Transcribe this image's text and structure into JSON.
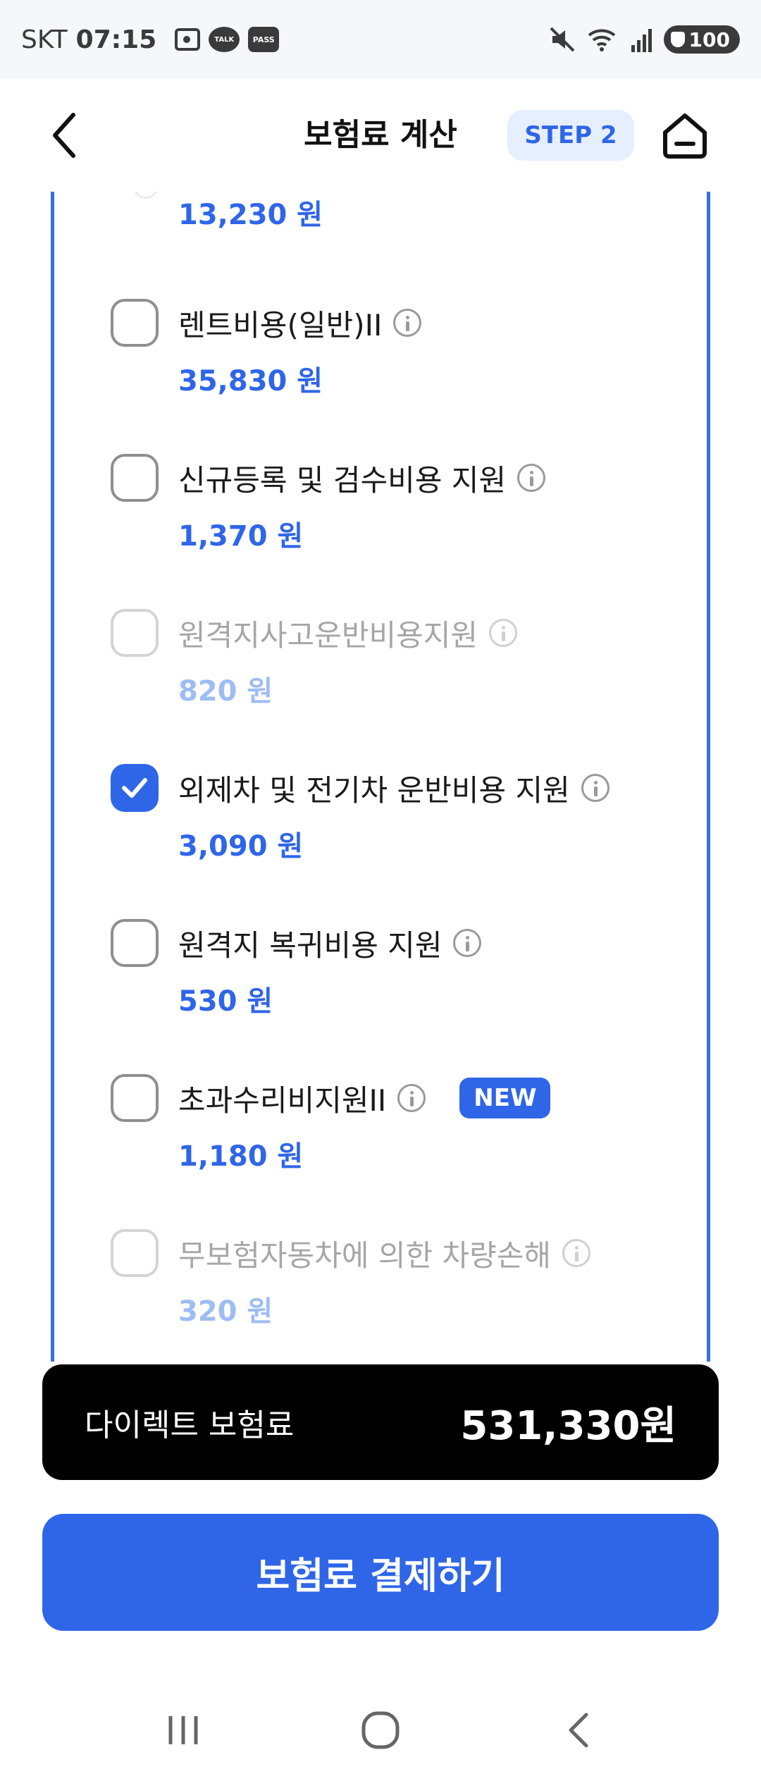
{
  "status_bar": {
    "carrier": "SKT",
    "time": "07:15",
    "talk_badge": "TALK",
    "pass_badge": "PASS",
    "battery": "100",
    "icons": [
      "gallery-icon",
      "kakaotalk-icon",
      "pass-icon",
      "mute-icon",
      "wifi-icon",
      "signal-icon",
      "battery-icon"
    ]
  },
  "header": {
    "title": "보험료 계산",
    "step": "STEP 2",
    "icons": [
      "back-arrow-icon",
      "home-icon"
    ]
  },
  "coverage_items": [
    {
      "label": "",
      "price": "13,230 원",
      "checked": false,
      "enabled": true,
      "partial": true
    },
    {
      "label": "렌트비용(일반)II",
      "price": "35,830 원",
      "checked": false,
      "enabled": true
    },
    {
      "label": "신규등록 및 검수비용 지원",
      "price": "1,370 원",
      "checked": false,
      "enabled": true
    },
    {
      "label": "원격지사고운반비용지원",
      "price": "820 원",
      "checked": false,
      "enabled": false
    },
    {
      "label": "외제차 및 전기차 운반비용 지원",
      "price": "3,090 원",
      "checked": true,
      "enabled": true
    },
    {
      "label": "원격지 복귀비용 지원",
      "price": "530 원",
      "checked": false,
      "enabled": true
    },
    {
      "label": "초과수리비지원II",
      "price": "1,180 원",
      "checked": false,
      "enabled": true,
      "badge": "NEW"
    },
    {
      "label": "무보험자동차에 의한 차량손해",
      "price": "320 원",
      "checked": false,
      "enabled": false
    }
  ],
  "total": {
    "label": "다이렉트 보험료",
    "amount": "531,330원"
  },
  "pay_button": {
    "label": "보험료 결제하기"
  },
  "colors": {
    "accent": "#2f66e8",
    "accent_light": "#e6efff",
    "disabled_price": "#9dbdf3",
    "total_bg": "#000000"
  }
}
